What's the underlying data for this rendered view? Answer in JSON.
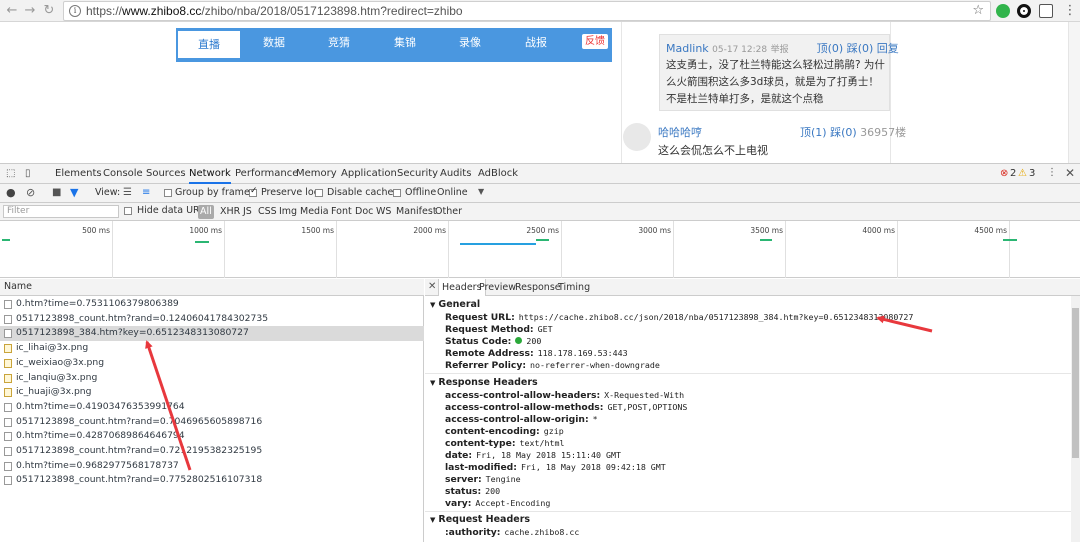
{
  "browser": {
    "url_prefix": "https://",
    "url_host": "www.zhibo8.cc",
    "url_path": "/zhibo/nba/2018/0517123898.htm?redirect=zhibo"
  },
  "site_nav": {
    "tabs": [
      "直播",
      "数据",
      "竞猜",
      "集锦",
      "录像",
      "战报"
    ],
    "feedback": "反馈"
  },
  "comments": {
    "quote_user": "Madlink",
    "quote_time": "05-17 12:28",
    "quote_report": "举报",
    "quote_votes": "顶(0) 踩(0)",
    "quote_reply": "回复",
    "quote_text": "这支勇士，没了杜兰特能这么轻松过鹃鹃? 为什么火箭围积这么多3d球员，就是为了打勇士！不是杜兰特单打多，是就这个点稳",
    "user2": "哈哈哈哼",
    "user2_votes": "顶(1) 踩(0)",
    "user2_floor": "36957楼",
    "user2_text": "这么会侃怎么不上电视"
  },
  "devtools": {
    "tabs": [
      "Elements",
      "Console",
      "Sources",
      "Network",
      "Performance",
      "Memory",
      "Application",
      "Security",
      "Audits",
      "AdBlock"
    ],
    "errors": "2",
    "warnings": "3",
    "view_label": "View:",
    "group_by_frame": "Group by frame",
    "preserve_log": "Preserve log",
    "disable_cache": "Disable cache",
    "offline": "Offline",
    "throttle": "Online",
    "filter_placeholder": "Filter",
    "hide_data_urls": "Hide data URLs",
    "filter_types": [
      "All",
      "XHR",
      "JS",
      "CSS",
      "Img",
      "Media",
      "Font",
      "Doc",
      "WS",
      "Manifest",
      "Other"
    ],
    "timeline_ticks": [
      "500 ms",
      "1000 ms",
      "1500 ms",
      "2000 ms",
      "2500 ms",
      "3000 ms",
      "3500 ms",
      "4000 ms",
      "4500 ms"
    ],
    "name_header": "Name",
    "requests": [
      "0.htm?time=0.7531106379806389",
      "0517123898_count.htm?rand=0.12406041784302735",
      "0517123898_384.htm?key=0.6512348313080727",
      "ic_lihai@3x.png",
      "ic_weixiao@3x.png",
      "ic_lanqiu@3x.png",
      "ic_huaji@3x.png",
      "0.htm?time=0.41903476353991764",
      "0517123898_count.htm?rand=0.7046965605898716",
      "0.htm?time=0.42870689864646794",
      "0517123898_count.htm?rand=0.7212195382325195",
      "0.htm?time=0.9682977568178737",
      "0517123898_count.htm?rand=0.7752802516107318"
    ],
    "detail_tabs": [
      "Headers",
      "Preview",
      "Response",
      "Timing"
    ],
    "general": {
      "title": "General",
      "items": [
        {
          "k": "Request URL:",
          "v": "https://cache.zhibo8.cc/json/2018/nba/0517123898_384.htm?key=0.6512348313080727"
        },
        {
          "k": "Request Method:",
          "v": "GET"
        },
        {
          "k": "Status Code:",
          "v": "200"
        },
        {
          "k": "Remote Address:",
          "v": "118.178.169.53:443"
        },
        {
          "k": "Referrer Policy:",
          "v": "no-referrer-when-downgrade"
        }
      ]
    },
    "response_headers": {
      "title": "Response Headers",
      "items": [
        {
          "k": "access-control-allow-headers:",
          "v": "X-Requested-With"
        },
        {
          "k": "access-control-allow-methods:",
          "v": "GET,POST,OPTIONS"
        },
        {
          "k": "access-control-allow-origin:",
          "v": "*"
        },
        {
          "k": "content-encoding:",
          "v": "gzip"
        },
        {
          "k": "content-type:",
          "v": "text/html"
        },
        {
          "k": "date:",
          "v": "Fri, 18 May 2018 15:11:40 GMT"
        },
        {
          "k": "last-modified:",
          "v": "Fri, 18 May 2018 09:42:18 GMT"
        },
        {
          "k": "server:",
          "v": "Tengine"
        },
        {
          "k": "status:",
          "v": "200"
        },
        {
          "k": "vary:",
          "v": "Accept-Encoding"
        }
      ]
    },
    "request_headers": {
      "title": "Request Headers",
      "items": [
        {
          "k": ":authority:",
          "v": "cache.zhibo8.cc"
        }
      ]
    }
  },
  "colors": {
    "accent": "#1a73e8",
    "nav_blue": "#4a97e0",
    "annotation_red": "#e8383d"
  }
}
